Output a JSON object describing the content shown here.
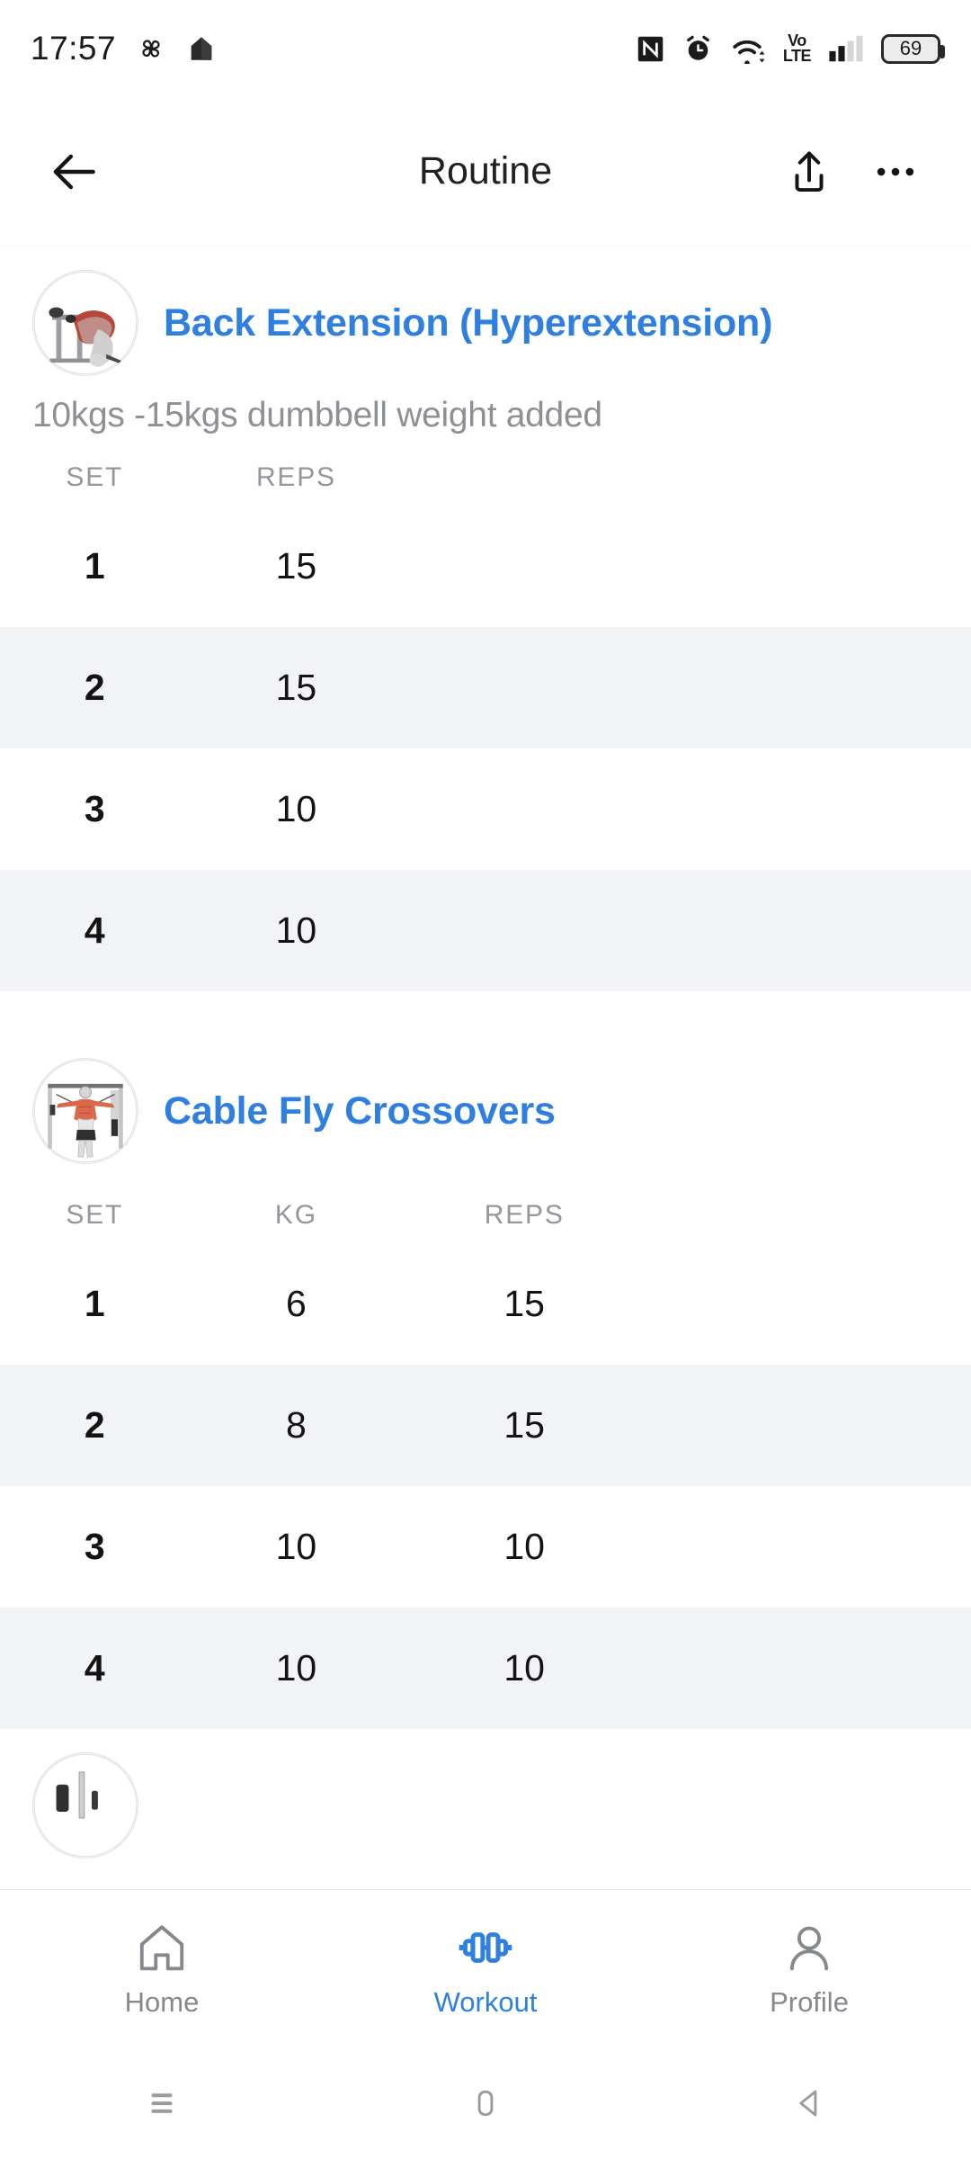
{
  "status_bar": {
    "time": "17:57",
    "battery_percent": "69",
    "volte_top": "Vo",
    "volte_bottom": "LTE",
    "icons": [
      "pinwheel-icon",
      "home-app-icon",
      "nfc-icon",
      "alarm-icon",
      "wifi-icon",
      "volte-icon",
      "signal-icon",
      "battery-icon"
    ]
  },
  "app_bar": {
    "title": "Routine",
    "back_label": "back-arrow",
    "share_label": "share",
    "more_label": "more-options"
  },
  "exercises": [
    {
      "title": "Back Extension (Hyperextension)",
      "note": "10kgs -15kgs dumbbell weight added",
      "thumb": "back-extension-thumbnail",
      "columns": [
        "SET",
        "REPS"
      ],
      "rows": [
        {
          "set": "1",
          "reps": "15"
        },
        {
          "set": "2",
          "reps": "15"
        },
        {
          "set": "3",
          "reps": "10"
        },
        {
          "set": "4",
          "reps": "10"
        }
      ]
    },
    {
      "title": "Cable Fly Crossovers",
      "note": "",
      "thumb": "cable-fly-crossovers-thumbnail",
      "columns": [
        "SET",
        "KG",
        "REPS"
      ],
      "rows": [
        {
          "set": "1",
          "kg": "6",
          "reps": "15"
        },
        {
          "set": "2",
          "kg": "8",
          "reps": "15"
        },
        {
          "set": "3",
          "kg": "10",
          "reps": "10"
        },
        {
          "set": "4",
          "kg": "10",
          "reps": "10"
        }
      ]
    }
  ],
  "bottom_nav": {
    "items": [
      {
        "label": "Home",
        "icon": "home-icon",
        "active": false
      },
      {
        "label": "Workout",
        "icon": "dumbbell-icon",
        "active": true
      },
      {
        "label": "Profile",
        "icon": "person-icon",
        "active": false
      }
    ]
  },
  "android_nav": {
    "recents": "recents-icon",
    "home": "home-pill-icon",
    "back": "back-triangle-icon"
  },
  "colors": {
    "accent": "#2e7fe0",
    "muted": "#8d9094",
    "row_alt": "#f1f3f6",
    "text": "#131313"
  }
}
